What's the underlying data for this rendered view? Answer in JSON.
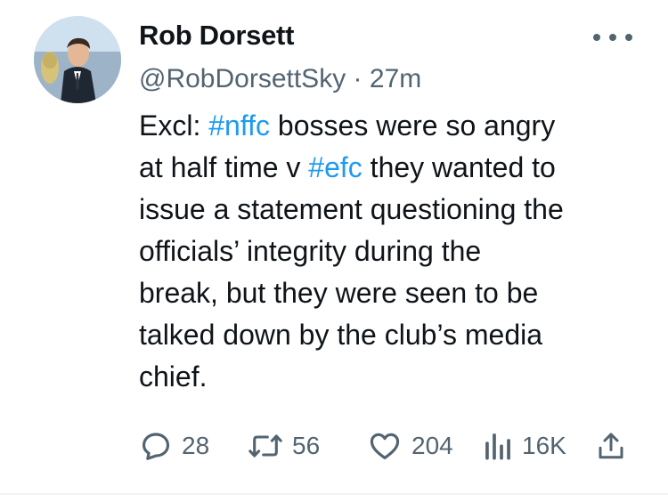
{
  "author": {
    "display_name": "Rob Dorsett",
    "handle": "@RobDorsettSky",
    "separator": "·",
    "time": "27m"
  },
  "tweet": {
    "lines": [
      [
        "Excl: ",
        "#nffc",
        " bosses were so angry"
      ],
      [
        "at half time v ",
        "#efc",
        " they wanted to"
      ],
      [
        "issue a statement questioning the"
      ],
      [
        "officials’ integrity during the"
      ],
      [
        "break, but they were seen to be"
      ],
      [
        "talked down by the club’s media"
      ],
      [
        "chief."
      ]
    ]
  },
  "actions": {
    "replies": "28",
    "reposts": "56",
    "likes": "204",
    "views": "16K"
  },
  "icons": {
    "more": "more-dots-icon",
    "reply": "reply-bubble-icon",
    "repost": "repost-icon",
    "like": "heart-icon",
    "views": "bar-chart-icon",
    "share": "share-icon"
  },
  "colors": {
    "text": "#0f1419",
    "secondary": "#536471",
    "hashtag": "#1d9bf0",
    "divider": "#eff3f4"
  }
}
